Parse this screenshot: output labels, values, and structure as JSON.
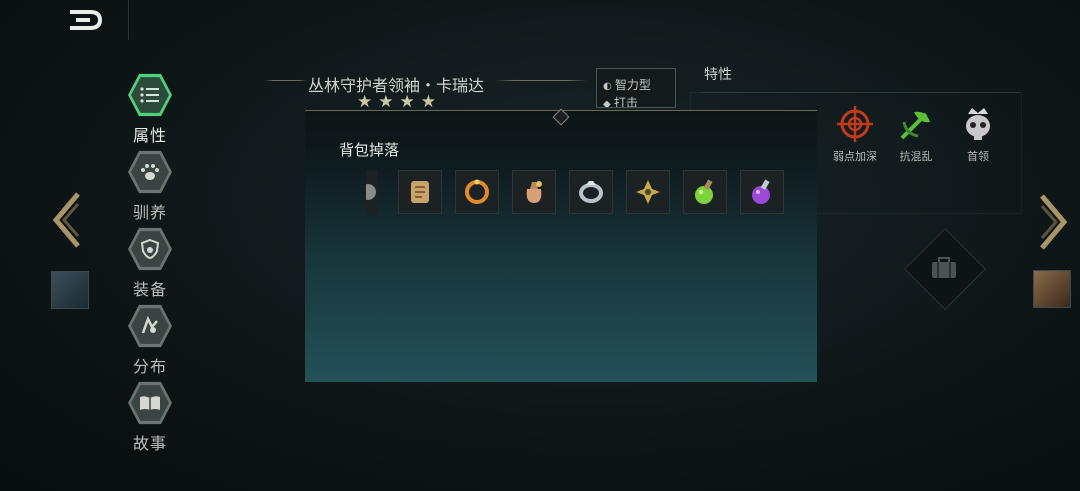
{
  "nav": {
    "items": [
      {
        "label": "属性",
        "icon": "list-icon",
        "active": true
      },
      {
        "label": "驯养",
        "icon": "paw-icon",
        "active": false
      },
      {
        "label": "装备",
        "icon": "shield-paw-icon",
        "active": false
      },
      {
        "label": "分布",
        "icon": "map-icon",
        "active": false
      },
      {
        "label": "故事",
        "icon": "book-icon",
        "active": false
      }
    ]
  },
  "character": {
    "name": "丛林守护者领袖・卡瑞达",
    "stars": "★★★★",
    "trait_box": {
      "line1": "智力型",
      "line2": "打击"
    }
  },
  "traits": {
    "title": "特性",
    "items": [
      {
        "label": "弱点加深",
        "icon": "crosshair-icon",
        "color": "#c23a1c"
      },
      {
        "label": "抗混乱",
        "icon": "leaf-sword-icon",
        "color": "#5bbf3a"
      },
      {
        "label": "首领",
        "icon": "skull-crown-icon",
        "color": "#c8c8c8"
      }
    ]
  },
  "popup": {
    "title": "背包掉落",
    "items": [
      {
        "icon": "scroll-icon",
        "color": "#c9a46a"
      },
      {
        "icon": "ring-icon",
        "color": "#e08a2a"
      },
      {
        "icon": "bag-icon",
        "color": "#d6a078"
      },
      {
        "icon": "silver-ring-icon",
        "color": "#b8c4cc"
      },
      {
        "icon": "gold-charm-icon",
        "color": "#c8a84a"
      },
      {
        "icon": "green-potion-icon",
        "color": "#7ed23a"
      },
      {
        "icon": "purple-potion-icon",
        "color": "#9a4ad6"
      }
    ]
  },
  "colors": {
    "accent_green": "#4fd07a",
    "arrow_gold": "#a89668"
  }
}
